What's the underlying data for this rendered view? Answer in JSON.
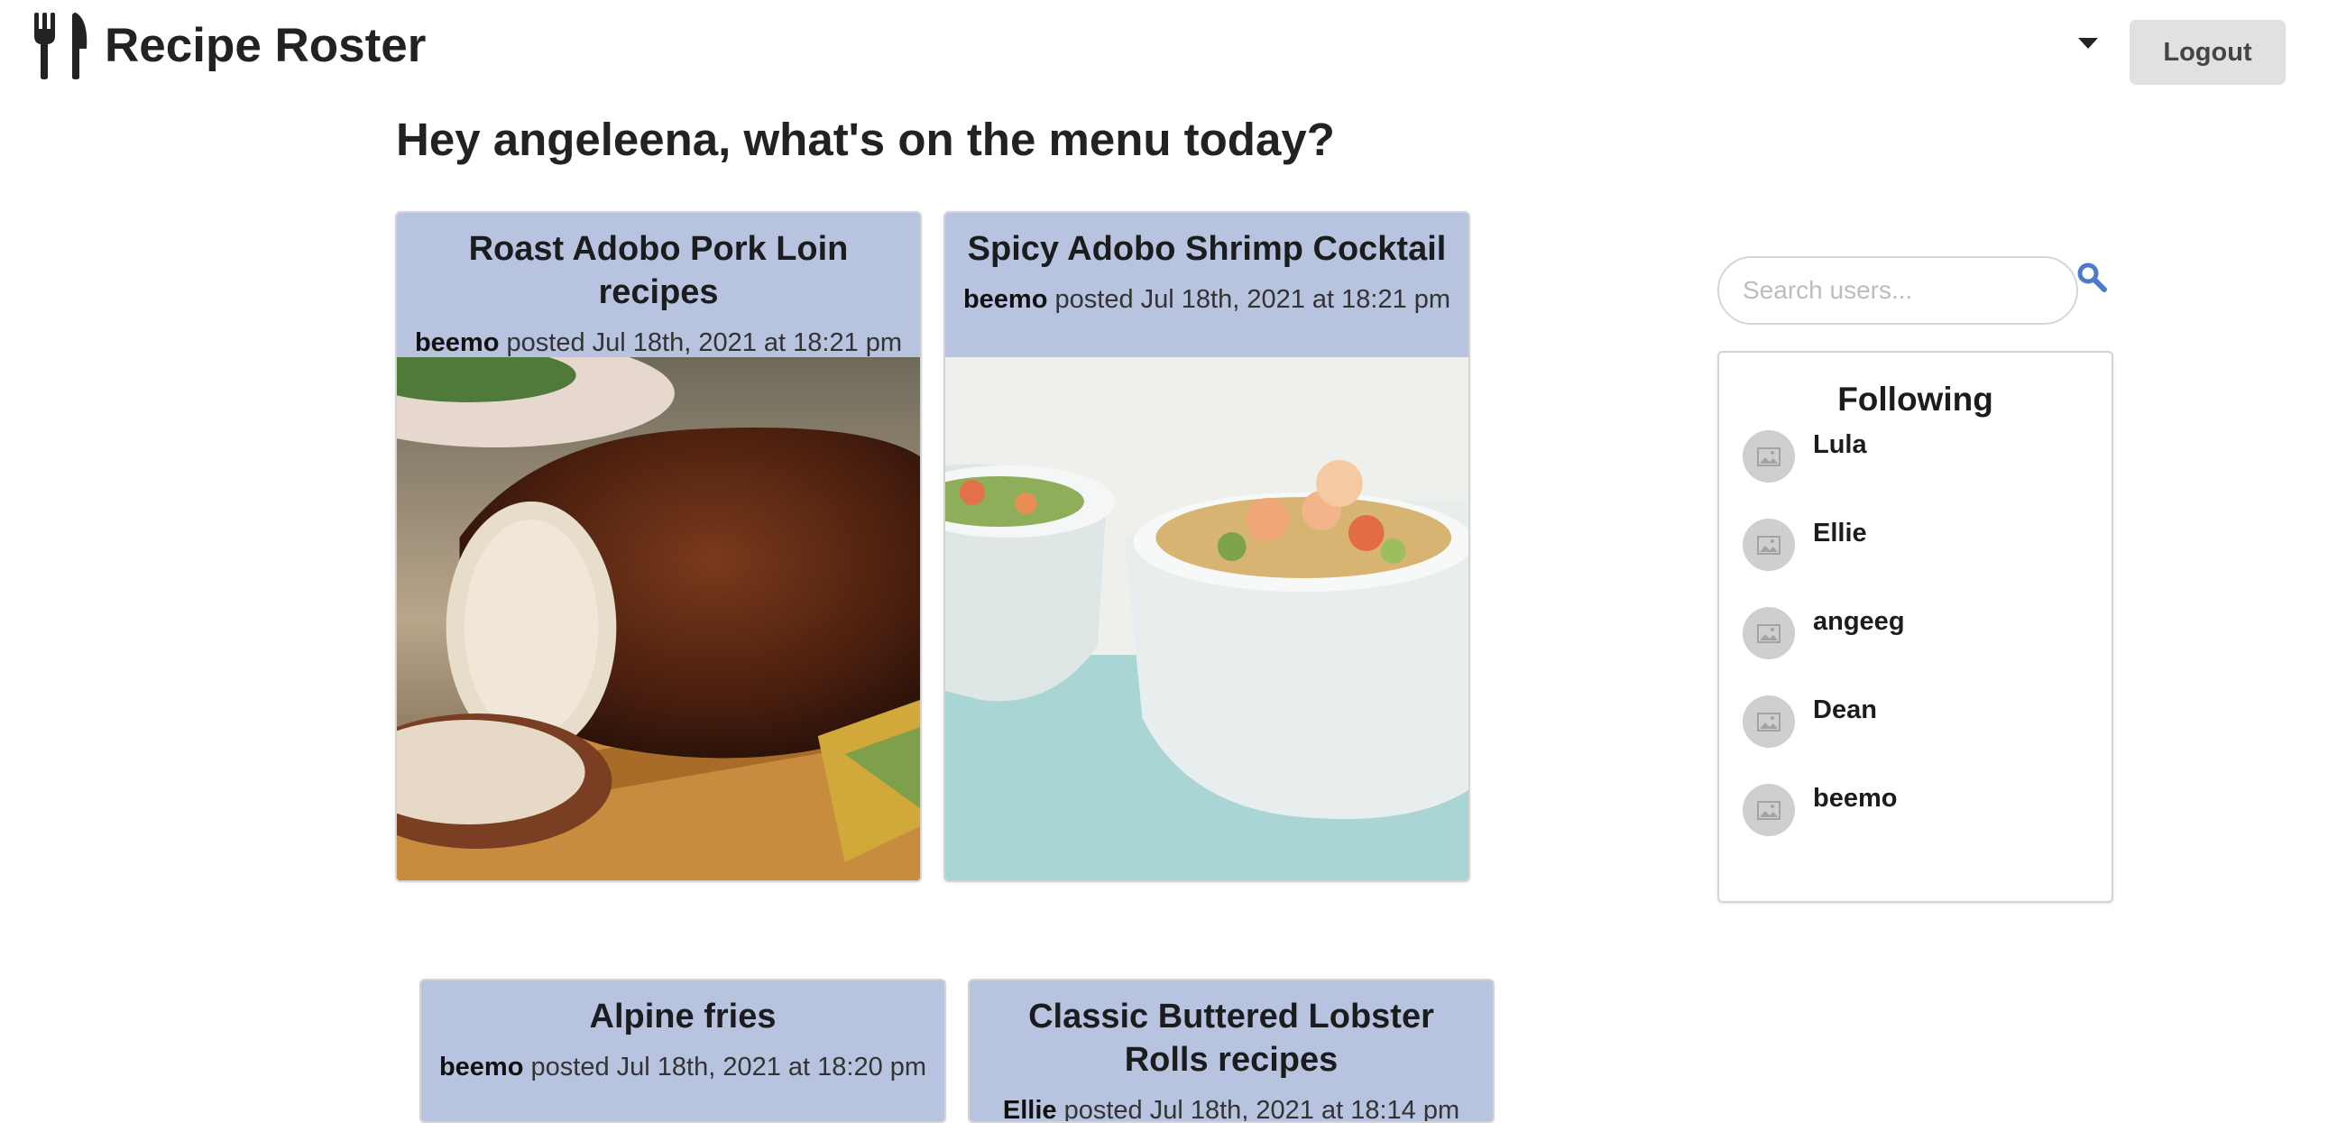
{
  "header": {
    "app_title": "Recipe Roster",
    "logout_label": "Logout"
  },
  "greeting": "Hey angeleena, what's on the menu today?",
  "recipes": [
    {
      "title": "Roast Adobo Pork Loin recipes",
      "author": "beemo",
      "posted": "posted Jul 18th, 2021 at 18:21 pm"
    },
    {
      "title": "Spicy Adobo Shrimp Cocktail",
      "author": "beemo",
      "posted": "posted Jul 18th, 2021 at 18:21 pm"
    },
    {
      "title": "Alpine fries",
      "author": "beemo",
      "posted": "posted Jul 18th, 2021 at 18:20 pm"
    },
    {
      "title": "Classic Buttered Lobster Rolls recipes",
      "author": "Ellie",
      "posted": "posted Jul 18th, 2021 at 18:14 pm"
    }
  ],
  "search": {
    "placeholder": "Search users..."
  },
  "following": {
    "title": "Following",
    "users": [
      "Lula",
      "Ellie",
      "angeeg",
      "Dean",
      "beemo"
    ]
  },
  "colors": {
    "card_header": "#b7c3df",
    "search_icon": "#4a7cc9",
    "logout_bg": "#e0e1e2"
  },
  "icons": {
    "logo": "fork-knife-icon",
    "dropdown": "caret-down-icon",
    "search": "search-icon",
    "avatar": "image-placeholder-icon"
  }
}
